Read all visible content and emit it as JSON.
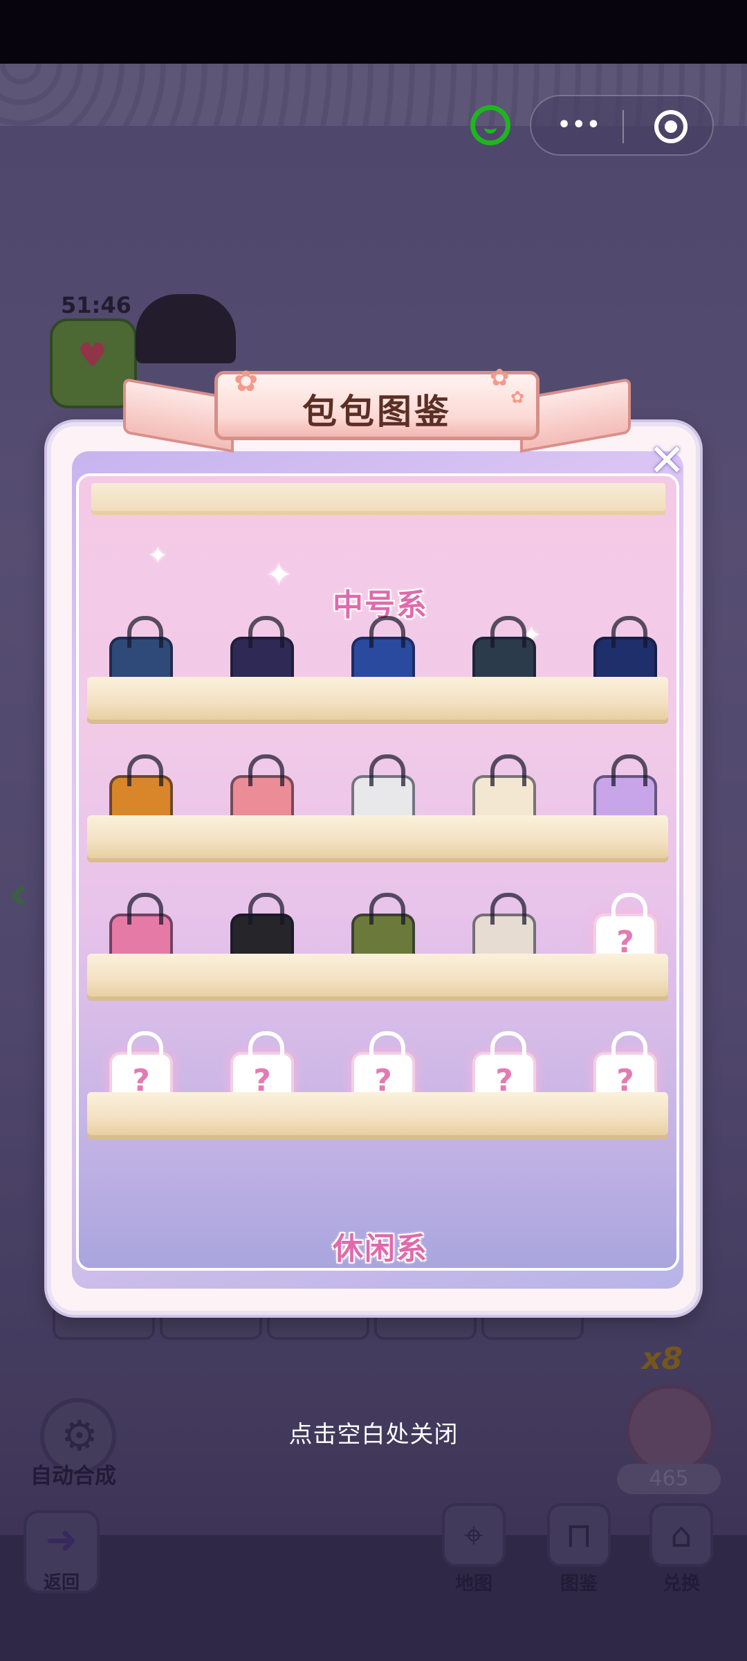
{
  "timer": "51:46",
  "modal": {
    "title": "包包图鉴",
    "section_1": "中号系",
    "section_2": "休闲系",
    "shelves": [
      {
        "bags": [
          {
            "name": "bag-navy-tote",
            "color": "#2f4a78",
            "locked": false
          },
          {
            "name": "bag-purple-quilted",
            "color": "#2f2a55",
            "locked": false
          },
          {
            "name": "bag-blue-satchel",
            "color": "#2a4aa0",
            "locked": false
          },
          {
            "name": "bag-dark-teal-bag",
            "color": "#2c3b4c",
            "locked": false
          },
          {
            "name": "bag-galaxy-bag",
            "color": "#1f2f6c",
            "locked": false
          }
        ]
      },
      {
        "bags": [
          {
            "name": "bag-orange-satchel",
            "color": "#d9862a",
            "locked": false
          },
          {
            "name": "bag-pink-satchel",
            "color": "#eb8c97",
            "locked": false
          },
          {
            "name": "bag-white-quilted",
            "color": "#e8e8ea",
            "locked": false
          },
          {
            "name": "bag-cream-chain",
            "color": "#f3e7d2",
            "locked": false
          },
          {
            "name": "bag-pastel-flap",
            "color": "#c7a5e8",
            "locked": false
          }
        ]
      },
      {
        "bags": [
          {
            "name": "bag-pink-hobo",
            "color": "#e67aa6",
            "locked": false
          },
          {
            "name": "bag-black-octagon",
            "color": "#25252a",
            "locked": false
          },
          {
            "name": "bag-olive-tote",
            "color": "#6b7a3a",
            "locked": false
          },
          {
            "name": "bag-beige-tote",
            "color": "#e6dcd2",
            "locked": false
          },
          {
            "name": "bag-unknown",
            "color": "#ffffff",
            "locked": true
          }
        ]
      },
      {
        "bags": [
          {
            "name": "bag-unknown",
            "color": "#ffffff",
            "locked": true
          },
          {
            "name": "bag-unknown",
            "color": "#ffffff",
            "locked": true
          },
          {
            "name": "bag-unknown",
            "color": "#ffffff",
            "locked": true
          },
          {
            "name": "bag-unknown",
            "color": "#ffffff",
            "locked": true
          },
          {
            "name": "bag-unknown",
            "color": "#ffffff",
            "locked": true
          }
        ]
      }
    ],
    "locked_mark": "?"
  },
  "close_hint": "点击空白处关闭",
  "background": {
    "auto_merge_label": "自动合成",
    "multiplier": "x8",
    "reward_count": "465",
    "return_label": "返回",
    "nav": {
      "map_label": "地图",
      "catalog_label": "图鉴",
      "exchange_label": "兑换"
    }
  },
  "capsule": {
    "more_icon": "more-dots-icon",
    "close_icon": "mini-program-close-icon"
  }
}
